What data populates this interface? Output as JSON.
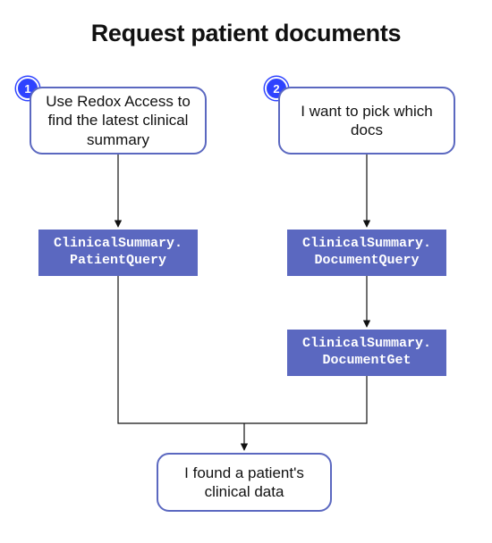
{
  "title": "Request patient documents",
  "steps": [
    {
      "num": "1",
      "prompt": "Use Redox Access to find the latest clinical summary"
    },
    {
      "num": "2",
      "prompt": "I want to pick which docs"
    }
  ],
  "api": {
    "patientQuery": "ClinicalSummary.\nPatientQuery",
    "documentQuery": "ClinicalSummary.\nDocumentQuery",
    "documentGet": "ClinicalSummary.\nDocumentGet"
  },
  "result": "I found a patient's clinical data"
}
